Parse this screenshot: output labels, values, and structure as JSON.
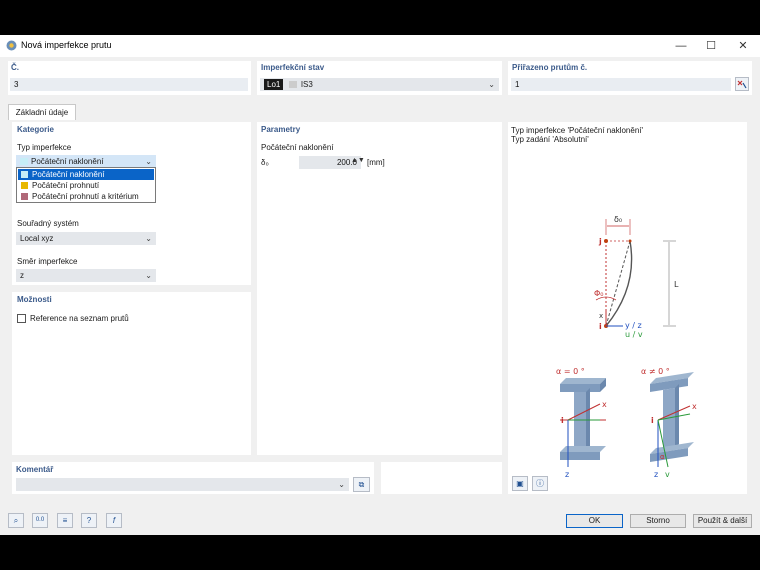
{
  "window": {
    "title": "Nová imperfekce prutu",
    "minimize": "—",
    "maximize": "☐",
    "close": "✕"
  },
  "header": {
    "no_label": "Č.",
    "no_value": "3",
    "case_label": "Imperfekční stav",
    "case_badge": "Lo1",
    "case_value": "IS3",
    "assigned_label": "Přiřazeno prutům č.",
    "assigned_value": "1"
  },
  "tabs": [
    {
      "label": "Základní údaje"
    }
  ],
  "category": {
    "title": "Kategorie",
    "type_label": "Typ imperfekce",
    "type_value": "Počáteční naklonění",
    "type_color": "#c6eef7",
    "options": [
      {
        "label": "Počáteční naklonění",
        "color": "#c6eef7",
        "selected": true
      },
      {
        "label": "Počáteční prohnutí",
        "color": "#e8b800"
      },
      {
        "label": "Počáteční prohnutí a kritérium",
        "color": "#b06878"
      }
    ],
    "coord_label": "Souřadný systém",
    "coord_value": "Local xyz",
    "direction_label": "Směr imperfekce",
    "direction_value": "z"
  },
  "options": {
    "title": "Možnosti",
    "reference_label": "Reference na seznam prutů",
    "reference_checked": false
  },
  "params": {
    "title": "Parametry",
    "subtitle": "Počáteční naklonění",
    "delta_symbol": "δ₀",
    "delta_value": "200.0",
    "delta_unit": "[mm]"
  },
  "info": {
    "line1": "Typ imperfekce 'Počáteční naklonění'",
    "line2": "Typ zadání 'Absolutní'"
  },
  "diagram": {
    "delta_label": "δ₀",
    "j_label": "j",
    "i_label": "i",
    "phi_label": "Φ₀",
    "x_label": "x",
    "yz_label": "y / z",
    "uv_label": "u / v",
    "L_label": "L",
    "alpha0_label": "α = 0 °",
    "alphaN_label": "α ≠ 0 °",
    "sec_x": "x",
    "sec_i": "i",
    "sec_z": "z",
    "sec_v": "v",
    "sec_alpha": "α"
  },
  "comment": {
    "title": "Komentář",
    "value": ""
  },
  "buttons": {
    "ok": "OK",
    "cancel": "Storno",
    "apply_next": "Použít & další"
  },
  "toolbar": [
    {
      "name": "search-tool-icon",
      "glyph": "⌕"
    },
    {
      "name": "units-tool-icon",
      "glyph": "0.0"
    },
    {
      "name": "list-tool-icon",
      "glyph": "≡"
    },
    {
      "name": "view-tool-icon",
      "glyph": "?"
    },
    {
      "name": "function-tool-icon",
      "glyph": "f"
    }
  ]
}
